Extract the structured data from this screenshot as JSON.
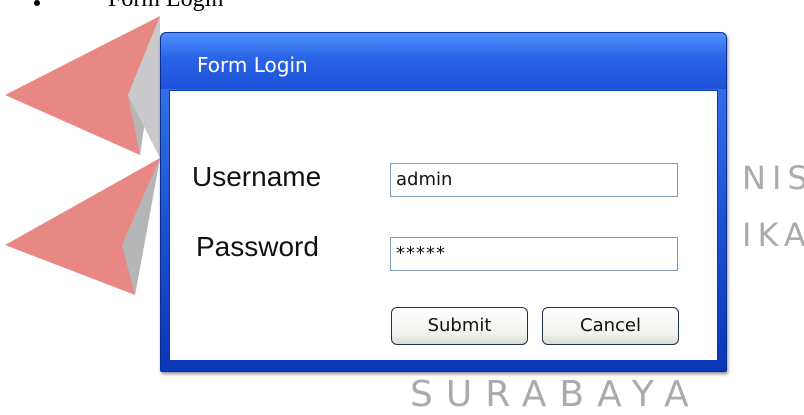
{
  "document": {
    "caption": "Form Login"
  },
  "watermark": {
    "line1": "NIS",
    "line2": "IKA",
    "line3": "SURABAYA"
  },
  "dialog": {
    "title": "Form Login",
    "username_label": "Username",
    "username_value": "admin",
    "password_label": "Password",
    "password_value": "*****",
    "submit_label": "Submit",
    "cancel_label": "Cancel"
  },
  "colors": {
    "titlebar": "#2a63e6",
    "frame": "#0b36b8",
    "logo_red": "#e88884",
    "logo_gray": "#b5b6b8",
    "watermark_text": "#a9abad"
  }
}
